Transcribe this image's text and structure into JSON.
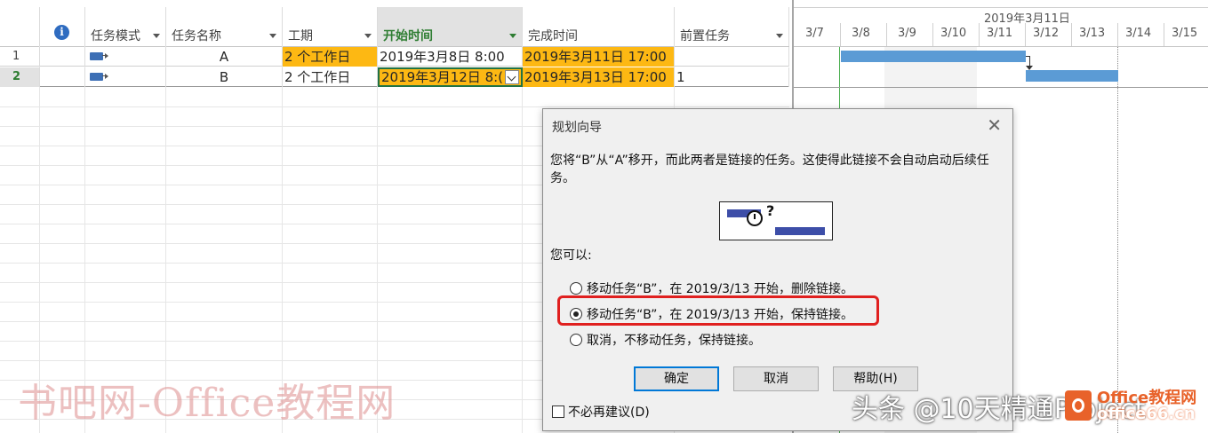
{
  "columns": [
    {
      "key": "info",
      "label": "",
      "icon": "info-icon"
    },
    {
      "key": "mode",
      "label": "任务模式"
    },
    {
      "key": "name",
      "label": "任务名称"
    },
    {
      "key": "duration",
      "label": "工期"
    },
    {
      "key": "start",
      "label": "开始时间"
    },
    {
      "key": "finish",
      "label": "完成时间"
    },
    {
      "key": "pred",
      "label": "前置任务"
    }
  ],
  "rows": [
    {
      "num": "1",
      "name": "A",
      "duration": "2 个工作日",
      "start": "2019年3月8日 8:00",
      "finish": "2019年3月11日 17:00",
      "pred": ""
    },
    {
      "num": "2",
      "name": "B",
      "duration": "2 个工作日",
      "start": "2019年3月12日 8:(",
      "finish": "2019年3月13日 17:00",
      "pred": "1"
    }
  ],
  "gantt": {
    "week_label": "2019年3月11日",
    "days": [
      "3/7",
      "3/8",
      "3/9",
      "3/10",
      "3/11",
      "3/12",
      "3/13",
      "3/14",
      "3/15"
    ]
  },
  "dialog": {
    "title": "规划向导",
    "message": "您将“B”从“A”移开，而此两者是链接的任务。这使得此链接不会自动启动后续任务。",
    "prompt": "您可以:",
    "options": [
      {
        "label": "移动任务“B”，在 2019/3/13 开始，删除链接。",
        "selected": false
      },
      {
        "label": "移动任务“B”，在 2019/3/13 开始，保持链接。",
        "selected": true
      },
      {
        "label": "取消，不移动任务，保持链接。",
        "selected": false
      }
    ],
    "ok": "确定",
    "cancel": "取消",
    "help": "帮助(H)",
    "dont_suggest": "不必再建议(D)"
  },
  "watermarks": {
    "left": "书吧网-Office教程网",
    "center": "头条 @10天精通Project",
    "logo_line1": "Office教程网",
    "logo_line2": "office66.cn"
  },
  "colors": {
    "highlight": "#fdb813",
    "bar": "#5b9bd5",
    "selected_header": "#2e7d32",
    "callout": "#e0201f"
  }
}
